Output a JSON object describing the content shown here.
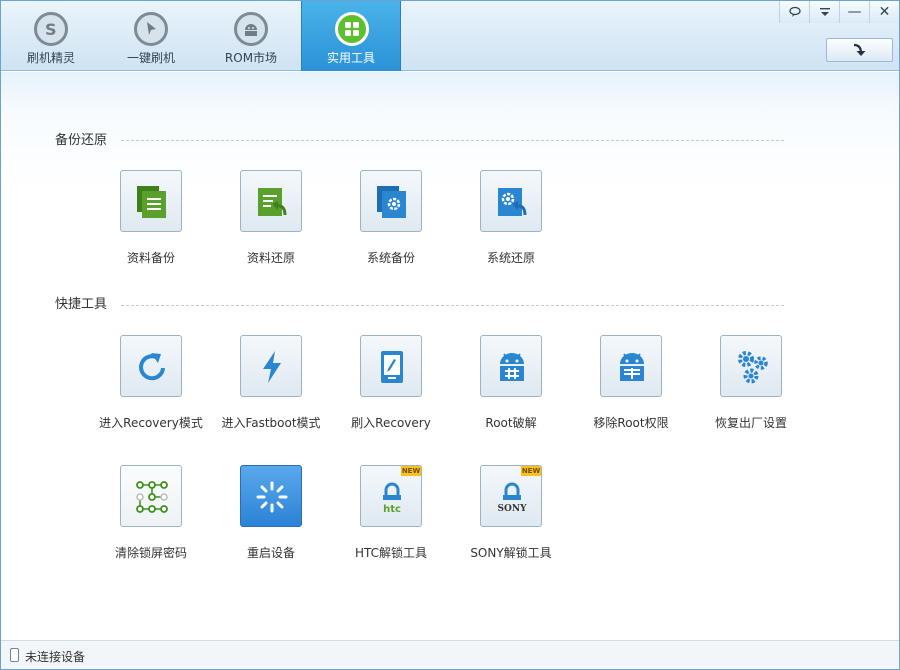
{
  "tabs": [
    {
      "label": "刷机精灵",
      "icon": "shield-s-icon"
    },
    {
      "label": "一键刷机",
      "icon": "cursor-icon"
    },
    {
      "label": "ROM市场",
      "icon": "android-icon"
    },
    {
      "label": "实用工具",
      "icon": "grid-icon",
      "active": true
    }
  ],
  "window_buttons": {
    "feedback": "feedback-icon",
    "menu": "menu-icon",
    "minimize": "—",
    "close": "✕"
  },
  "back_button": {
    "icon": "return-arrow-icon"
  },
  "sections": [
    {
      "title": "备份还原",
      "tools": [
        {
          "label": "资料备份",
          "icon": "data-backup-icon"
        },
        {
          "label": "资料还原",
          "icon": "data-restore-icon"
        },
        {
          "label": "系统备份",
          "icon": "system-backup-icon"
        },
        {
          "label": "系统还原",
          "icon": "system-restore-icon"
        }
      ]
    },
    {
      "title": "快捷工具",
      "tools": [
        {
          "label": "进入Recovery模式",
          "icon": "refresh-icon"
        },
        {
          "label": "进入Fastboot模式",
          "icon": "lightning-icon"
        },
        {
          "label": "刷入Recovery",
          "icon": "flash-phone-icon"
        },
        {
          "label": "Root破解",
          "icon": "android-root-icon"
        },
        {
          "label": "移除Root权限",
          "icon": "android-unroot-icon"
        },
        {
          "label": "恢复出厂设置",
          "icon": "gears-icon"
        },
        {
          "label": "清除锁屏密码",
          "icon": "pattern-lock-icon"
        },
        {
          "label": "重启设备",
          "icon": "loading-icon"
        },
        {
          "label": "HTC解锁工具",
          "icon": "htc-lock-icon",
          "badge": "NEW",
          "brand": "htc"
        },
        {
          "label": "SONY解锁工具",
          "icon": "sony-lock-icon",
          "badge": "NEW",
          "brand": "SONY"
        }
      ]
    }
  ],
  "status": {
    "text": "未连接设备",
    "icon": "phone-icon"
  },
  "colors": {
    "accent": "#2b92d6",
    "green": "#5aa02c",
    "icon_blue": "#2a86d1"
  }
}
